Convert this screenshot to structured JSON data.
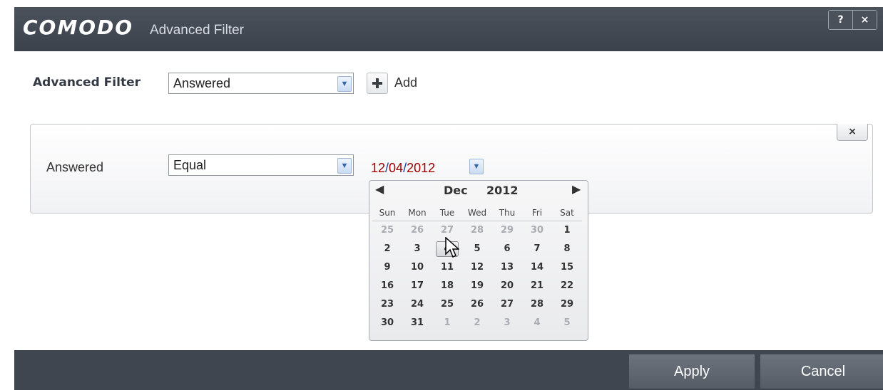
{
  "window": {
    "brand": "COMODO",
    "title": "Advanced Filter",
    "help_label": "?",
    "close_label": "×"
  },
  "filter": {
    "label": "Advanced Filter",
    "selected": "Answered",
    "add_label": "Add"
  },
  "condition": {
    "field_label": "Answered",
    "operator": "Equal",
    "remove_label": "×",
    "date": {
      "month": "12",
      "sep1": "/",
      "day": "04",
      "sep2": "/",
      "year": "2012"
    }
  },
  "calendar": {
    "prev": "◀",
    "next": "▶",
    "month": "Dec",
    "year": "2012",
    "weekdays": [
      "Sun",
      "Mon",
      "Tue",
      "Wed",
      "Thu",
      "Fri",
      "Sat"
    ],
    "weeks": [
      [
        {
          "d": "25",
          "other": true
        },
        {
          "d": "26",
          "other": true
        },
        {
          "d": "27",
          "other": true
        },
        {
          "d": "28",
          "other": true
        },
        {
          "d": "29",
          "other": true
        },
        {
          "d": "30",
          "other": true
        },
        {
          "d": "1"
        }
      ],
      [
        {
          "d": "2"
        },
        {
          "d": "3"
        },
        {
          "d": "4",
          "selected": true
        },
        {
          "d": "5"
        },
        {
          "d": "6"
        },
        {
          "d": "7"
        },
        {
          "d": "8"
        }
      ],
      [
        {
          "d": "9"
        },
        {
          "d": "10"
        },
        {
          "d": "11"
        },
        {
          "d": "12"
        },
        {
          "d": "13"
        },
        {
          "d": "14"
        },
        {
          "d": "15"
        }
      ],
      [
        {
          "d": "16"
        },
        {
          "d": "17"
        },
        {
          "d": "18"
        },
        {
          "d": "19"
        },
        {
          "d": "20"
        },
        {
          "d": "21"
        },
        {
          "d": "22"
        }
      ],
      [
        {
          "d": "23"
        },
        {
          "d": "24"
        },
        {
          "d": "25"
        },
        {
          "d": "26"
        },
        {
          "d": "27"
        },
        {
          "d": "28"
        },
        {
          "d": "29"
        }
      ],
      [
        {
          "d": "30"
        },
        {
          "d": "31"
        },
        {
          "d": "1",
          "other": true
        },
        {
          "d": "2",
          "other": true
        },
        {
          "d": "3",
          "other": true
        },
        {
          "d": "4",
          "other": true
        },
        {
          "d": "5",
          "other": true
        }
      ]
    ]
  },
  "footer": {
    "apply_label": "Apply",
    "cancel_label": "Cancel"
  },
  "colors": {
    "chrome": "#3f4650",
    "date_red": "#a00000",
    "date_blue": "#1a3c9c"
  }
}
